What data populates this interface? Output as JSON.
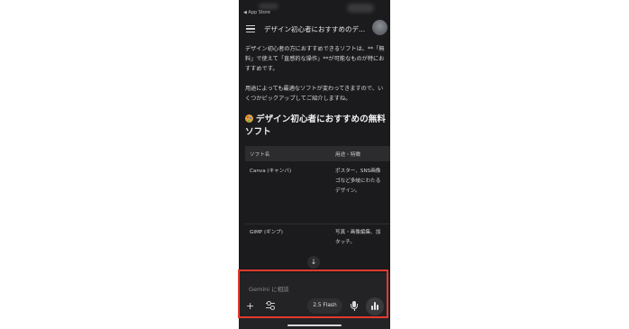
{
  "status_bar": {
    "back_label": "◀ App Store"
  },
  "header": {
    "title": "デザイン初心者におすすめのデ..."
  },
  "content": {
    "paragraph1": "デザイン初心者の方におすすめできるソフトは、**「無料」で使えて「直感的な操作」**が可能なものが特におすすめです。",
    "paragraph2": "用途によっても最適なソフトが変わってきますので、いくつかピックアップしてご紹介しますね。",
    "heading": "デザイン初心者におすすめの無料ソフト",
    "table": {
      "headers": [
        "ソフト名",
        "用途・特徴"
      ],
      "rows": [
        {
          "name": "Canva (キャンバ)",
          "desc": [
            "ポスター、SNS画像",
            "ゴなど多岐にわたる",
            "デザイン。"
          ]
        },
        {
          "name": "GIMP (ギンプ)",
          "desc": [
            "写真・画像編集、加",
            "タッチ。"
          ]
        }
      ]
    }
  },
  "input": {
    "placeholder": "Gemini に相談",
    "model_label": "2.5 Flash"
  },
  "colors": {
    "highlight": "#e23a2f",
    "background": "#1b1b1d"
  }
}
